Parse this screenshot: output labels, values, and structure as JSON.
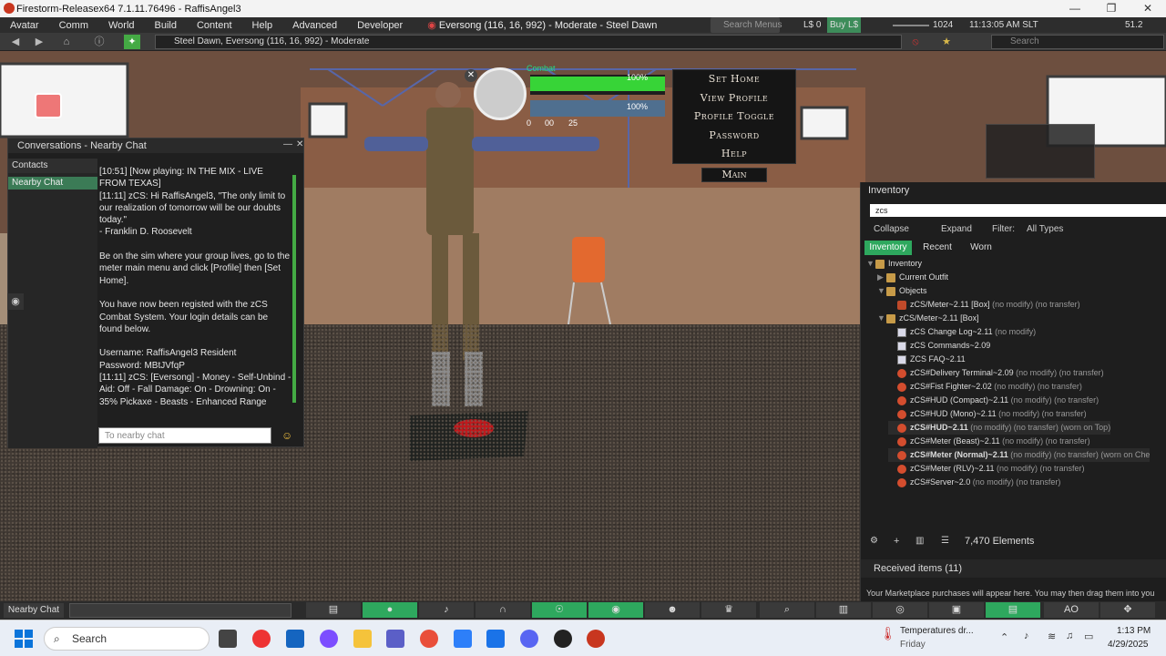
{
  "window": {
    "title": "Firestorm-Releasex64 7.1.11.76496 - RaffisAngel3",
    "minimize": "—",
    "maximize": "❐",
    "close": "✕"
  },
  "menubar": {
    "items": [
      "Avatar",
      "Comm",
      "World",
      "Build",
      "Content",
      "Help",
      "Advanced",
      "Developer"
    ],
    "location": "Eversong (116, 16, 992) - Moderate - Steel Dawn",
    "search_menus": "Search Menus",
    "currency": "L$ 0",
    "buy": "Buy L$",
    "fps_count": "1024",
    "time": "11:13:05 AM SLT",
    "fps": "51.2"
  },
  "navbar": {
    "location": "Steel Dawn, Eversong (116, 16, 992) - Moderate",
    "search_placeholder": "Search"
  },
  "chat": {
    "title": "Conversations - Nearby Chat",
    "contacts_tab": "Contacts",
    "nearby_tab": "Nearby Chat",
    "messages": "[10:51] [Now playing: IN THE MIX - LIVE FROM TEXAS]\n[11:11] zCS: Hi RaffisAngel3, \"The only limit to our realization of tomorrow will be our doubts today.\"\n- Franklin D. Roosevelt\n\nBe on the sim where your group lives, go to the meter main menu and click [Profile] then [Set Home].\n\nYou have now been registed with the zCS Combat System. Your login details can be found below.\n\nUsername: RaffisAngel3 Resident\nPassword: MBtJVfqP\n[11:11] zCS: [Eversong] - Money - Self-Unbind - Aid: Off - Fall Damage: On - Drowning: On - 35% Pickaxe - Beasts - Enhanced Range",
    "input_placeholder": "To nearby chat"
  },
  "hud": {
    "combat_label": "Combat",
    "health": "100%",
    "stamina": "100%",
    "coins": [
      "0",
      "00",
      "25"
    ]
  },
  "hud_menu": {
    "items": [
      "Set Home",
      "View Profile",
      "Profile Toggle",
      "Password",
      "Help"
    ],
    "main": "Main"
  },
  "inventory": {
    "title": "Inventory",
    "filter_value": "zcs",
    "collapse": "Collapse",
    "expand": "Expand",
    "filter_label": "Filter:",
    "filter_type": "All Types",
    "tabs": [
      "Inventory",
      "Recent",
      "Worn"
    ],
    "tree": [
      {
        "indent": 0,
        "label": "Inventory",
        "suffix": "",
        "icon": "folder",
        "exp": "▼",
        "bold": false
      },
      {
        "indent": 1,
        "label": "Current Outfit",
        "suffix": "",
        "icon": "folder",
        "exp": "▶",
        "bold": false
      },
      {
        "indent": 1,
        "label": "Objects",
        "suffix": "",
        "icon": "folder",
        "exp": "▼",
        "bold": false
      },
      {
        "indent": 2,
        "label": "zCS/Meter~2.11 [Box]",
        "suffix": " (no modify) (no transfer)",
        "icon": "box",
        "exp": "",
        "bold": false
      },
      {
        "indent": 1,
        "label": "zCS/Meter~2.11 [Box]",
        "suffix": "",
        "icon": "folder",
        "exp": "▼",
        "bold": false
      },
      {
        "indent": 2,
        "label": "zCS Change Log~2.11",
        "suffix": " (no modify)",
        "icon": "note",
        "exp": "",
        "bold": false
      },
      {
        "indent": 2,
        "label": "zCS Commands~2.09",
        "suffix": "",
        "icon": "note",
        "exp": "",
        "bold": false
      },
      {
        "indent": 2,
        "label": "ZCS FAQ~2.11",
        "suffix": "",
        "icon": "note",
        "exp": "",
        "bold": false
      },
      {
        "indent": 2,
        "label": "zCS#Delivery Terminal~2.09",
        "suffix": " (no modify) (no transfer)",
        "icon": "obj",
        "exp": "",
        "bold": false
      },
      {
        "indent": 2,
        "label": "zCS#Fist Fighter~2.02",
        "suffix": " (no modify) (no transfer)",
        "icon": "obj",
        "exp": "",
        "bold": false
      },
      {
        "indent": 2,
        "label": "zCS#HUD (Compact)~2.11",
        "suffix": " (no modify) (no transfer)",
        "icon": "obj",
        "exp": "",
        "bold": false
      },
      {
        "indent": 2,
        "label": "zCS#HUD (Mono)~2.11",
        "suffix": " (no modify) (no transfer)",
        "icon": "obj",
        "exp": "",
        "bold": false
      },
      {
        "indent": 2,
        "label": "zCS#HUD~2.11",
        "suffix": " (no modify) (no transfer) (worn on Top)",
        "icon": "obj",
        "exp": "",
        "bold": true
      },
      {
        "indent": 2,
        "label": "zCS#Meter (Beast)~2.11",
        "suffix": " (no modify) (no transfer)",
        "icon": "obj",
        "exp": "",
        "bold": false
      },
      {
        "indent": 2,
        "label": "zCS#Meter (Normal)~2.11",
        "suffix": " (no modify) (no transfer) (worn on Che",
        "icon": "obj",
        "exp": "",
        "bold": true
      },
      {
        "indent": 2,
        "label": "zCS#Meter (RLV)~2.11",
        "suffix": " (no modify) (no transfer)",
        "icon": "obj",
        "exp": "",
        "bold": false
      },
      {
        "indent": 2,
        "label": "zCS#Server~2.0",
        "suffix": " (no modify) (no transfer)",
        "icon": "obj",
        "exp": "",
        "bold": false
      }
    ],
    "element_count": "7,470 Elements",
    "received": "Received items (11)",
    "marketplace_note": "Your Marketplace purchases will appear here. You may then drag them into you"
  },
  "bottombar": {
    "nearby_chat": "Nearby Chat",
    "ao": "AO"
  },
  "taskbar": {
    "search": "Search",
    "weather": "Temperatures dr...",
    "weather_day": "Friday",
    "time": "1:13 PM",
    "date": "4/29/2025"
  }
}
